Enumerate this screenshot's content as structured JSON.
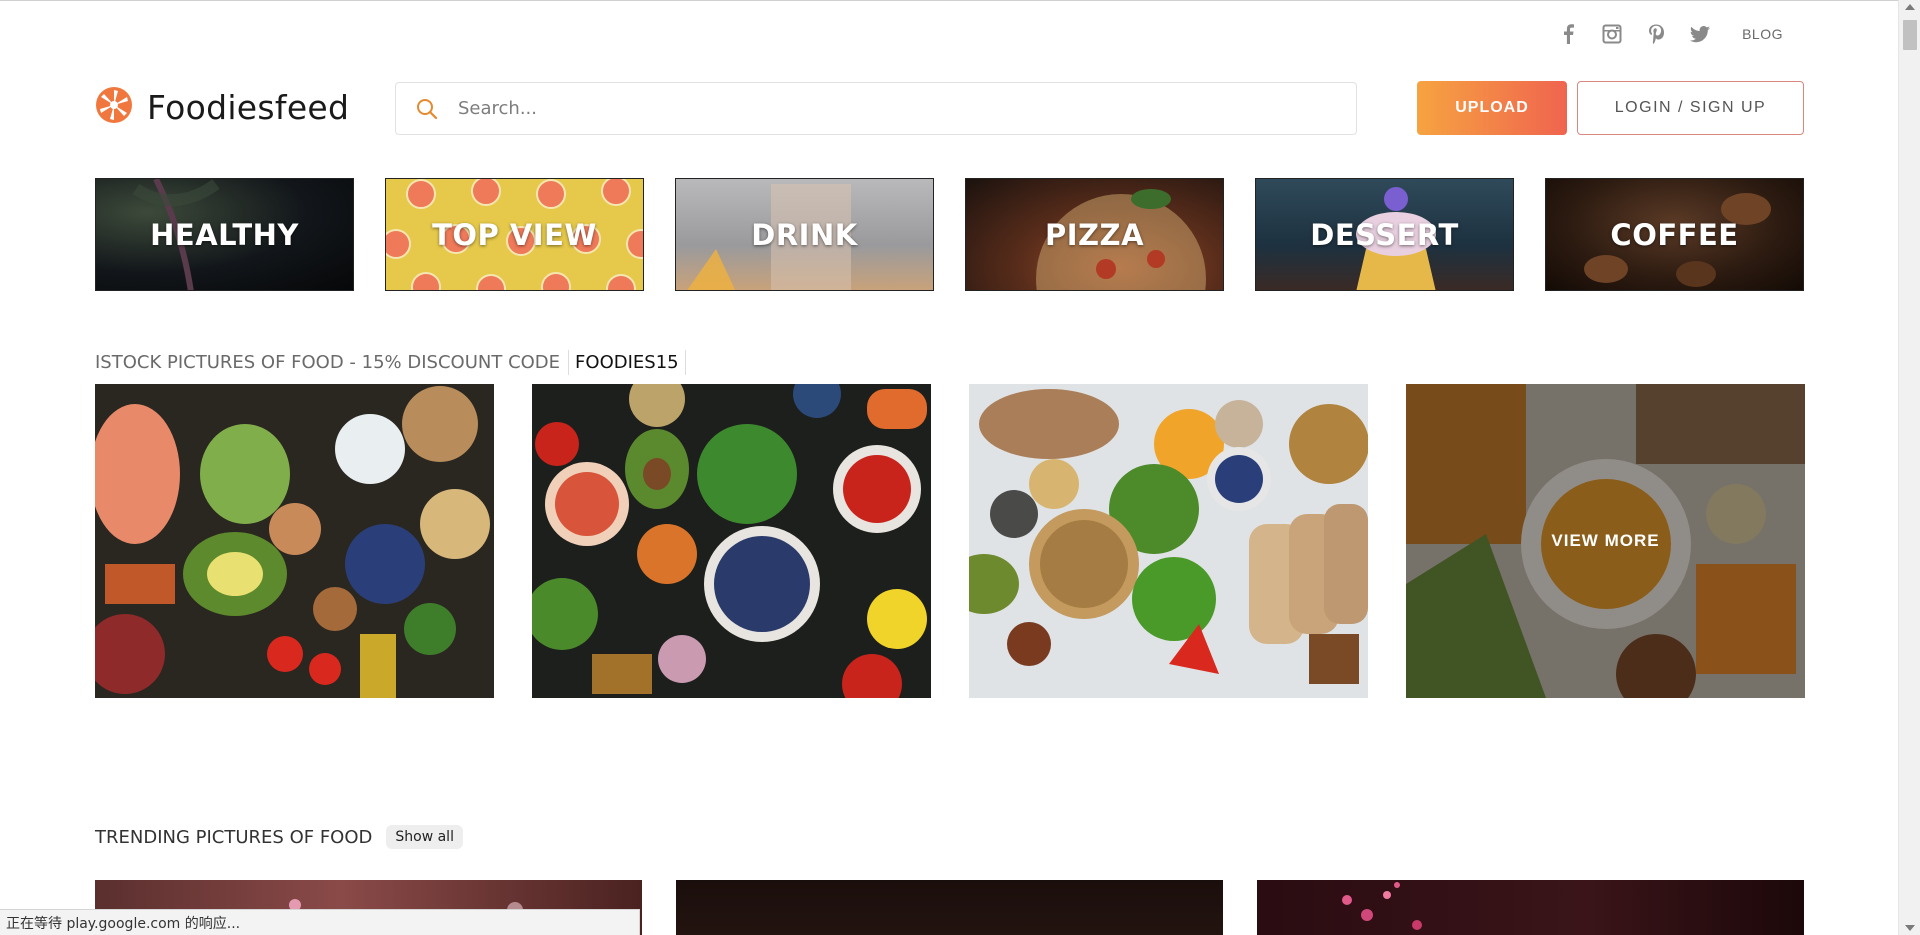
{
  "social": {
    "facebook_icon": "facebook-icon",
    "instagram_icon": "instagram-icon",
    "pinterest_icon": "pinterest-icon",
    "twitter_icon": "twitter-icon",
    "blog_label": "BLOG"
  },
  "header": {
    "logo_text": "Foodiesfeed",
    "search_placeholder": "Search...",
    "upload_label": "UPLOAD",
    "login_label": "LOGIN / SIGN UP"
  },
  "categories": [
    {
      "label": "HEALTHY"
    },
    {
      "label": "TOP VIEW"
    },
    {
      "label": "DRINK"
    },
    {
      "label": "PIZZA"
    },
    {
      "label": "DESSERT"
    },
    {
      "label": "COFFEE"
    }
  ],
  "istock": {
    "title": "ISTOCK PICTURES OF FOOD - 15% DISCOUNT CODE",
    "code": "FOODIES15",
    "view_more": "VIEW MORE"
  },
  "trending": {
    "title": "TRENDING PICTURES OF FOOD",
    "show_all": "Show all"
  },
  "status": {
    "text": "正在等待 play.google.com 的响应..."
  },
  "colors": {
    "accent_start": "#f6a341",
    "accent_end": "#f0644f"
  }
}
